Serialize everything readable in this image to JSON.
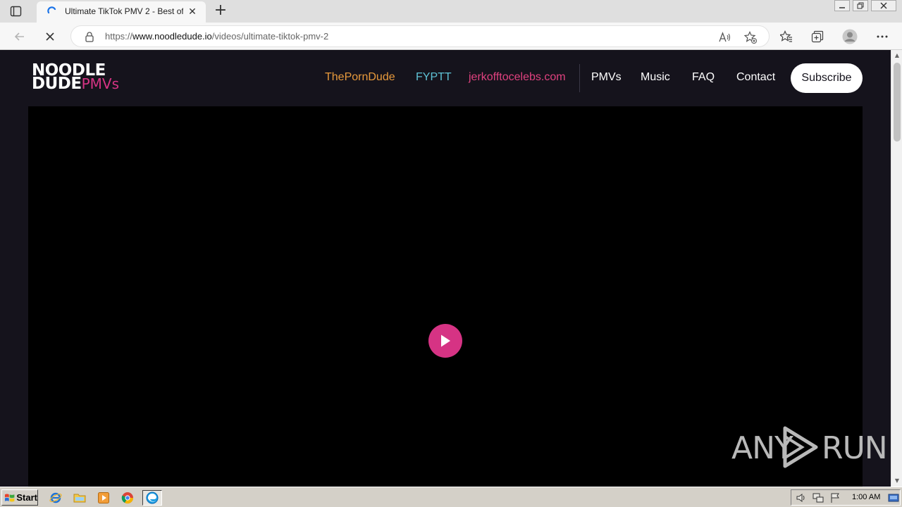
{
  "browser": {
    "tab_title": "Ultimate TikTok PMV 2 - Best of",
    "tab_close": "✕",
    "new_tab": "+",
    "url_scheme": "https://",
    "url_host": "www.noodledude.io",
    "url_path": "/videos/ultimate-tiktok-pmv-2"
  },
  "site": {
    "logo_line1": "NOODLE",
    "logo_line2_main": "DUDE",
    "logo_line2_accent": "PMVs",
    "nav": [
      {
        "label": "ThePornDude",
        "color": "#e89a3c"
      },
      {
        "label": "FYPTT",
        "color": "#5fc3d6"
      },
      {
        "label": "jerkofftocelebs.com",
        "color": "#e0427f"
      },
      {
        "label": "PMVs",
        "color": "#ffffff"
      },
      {
        "label": "Music",
        "color": "#ffffff"
      },
      {
        "label": "FAQ",
        "color": "#ffffff"
      },
      {
        "label": "Contact",
        "color": "#ffffff"
      }
    ],
    "subscribe_label": "Subscribe",
    "accent_color": "#d63384",
    "background_color": "#15131c"
  },
  "watermark": {
    "left": "ANY",
    "right": "RUN"
  },
  "taskbar": {
    "start_label": "Start",
    "clock": "1:00 AM",
    "apps": [
      "internet-explorer-icon",
      "folder-icon",
      "media-player-icon",
      "chrome-icon",
      "edge-icon"
    ]
  }
}
